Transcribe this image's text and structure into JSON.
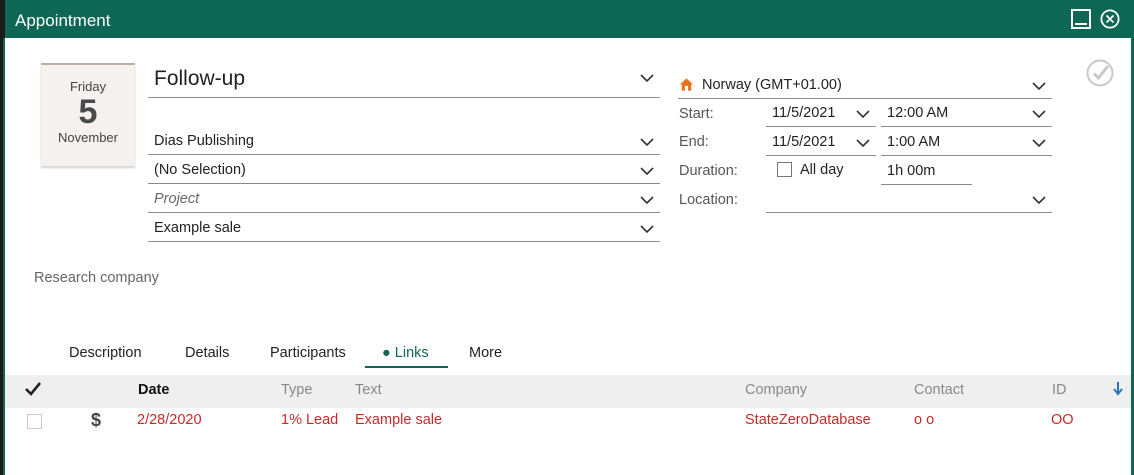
{
  "window": {
    "title": "Appointment"
  },
  "calendar": {
    "weekday": "Friday",
    "day": "5",
    "month": "November"
  },
  "form": {
    "title_value": "Follow-up",
    "company_value": "Dias Publishing",
    "contact_value": "(No Selection)",
    "project_placeholder": "Project",
    "sale_value": "Example sale",
    "note": "Research company"
  },
  "schedule": {
    "timezone": "Norway (GMT+01.00)",
    "start_label": "Start:",
    "start_date": "11/5/2021",
    "start_time": "12:00 AM",
    "end_label": "End:",
    "end_date": "11/5/2021",
    "end_time": "1:00 AM",
    "duration_label": "Duration:",
    "allday_label": "All day",
    "duration_value": "1h 00m",
    "location_label": "Location:",
    "location_value": ""
  },
  "tabs": [
    {
      "label": "Description"
    },
    {
      "label": "Details"
    },
    {
      "label": "Participants"
    },
    {
      "label": "● Links",
      "active": true
    },
    {
      "label": "More"
    }
  ],
  "links_table": {
    "columns": [
      "Date",
      "Type",
      "Text",
      "Company",
      "Contact",
      "ID"
    ],
    "rows": [
      {
        "icon": "dollar-icon",
        "date": "2/28/2020",
        "type": "1% Lead",
        "text": "Example sale",
        "company": "StateZeroDatabase",
        "contact": "o o",
        "id": "OO"
      }
    ]
  },
  "colors": {
    "accent": "#0e6654",
    "link_red": "#c62a2a",
    "header_bg": "#efefef"
  }
}
